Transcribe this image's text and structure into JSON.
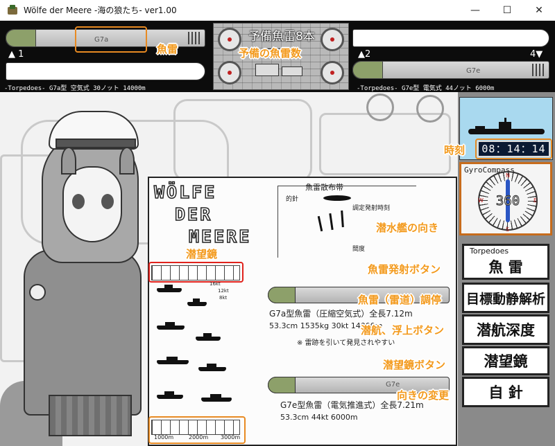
{
  "window": {
    "title": "Wölfe der Meere -海の狼たち- ver1.00",
    "minimize": "—",
    "maximize": "☐",
    "close": "✕"
  },
  "topbar": {
    "reserve_text": "予備魚雷8本",
    "tube1": {
      "number": "▲ 1",
      "torpedo_type": "G7a",
      "info": "-Torpedoes-  G7a型 空気式   30ノット  14000m"
    },
    "tube2": {
      "number": "▲2"
    },
    "tube4": {
      "number": "4▼",
      "torpedo_type": "G7e",
      "info": "-Torpedoes-  G7e型 電気式   44ノット  6000m"
    }
  },
  "clock": {
    "time": "08：14：14"
  },
  "compass": {
    "title": "GyroCompass",
    "heading": "360",
    "marks": [
      "N",
      "E",
      "S",
      "W"
    ]
  },
  "buttons": {
    "fire_caption": "Torpedoes",
    "fire": "魚 雷",
    "analysis": "目標動静解析",
    "depth": "潜航深度",
    "periscope": "潜望鏡",
    "heading": "自 針"
  },
  "annotations": {
    "torpedo": "魚雷",
    "reserve": "予備の魚雷数",
    "time": "時刻",
    "sub_heading": "潜水艦の向き",
    "periscope": "潜望鏡",
    "fire_button": "魚雷発射ボタン",
    "adjust": "魚雷（雷道）調停",
    "dive_button": "潜航、浮上ボタン",
    "periscope_button": "潜望鏡ボタン",
    "change_heading": "向きの変更"
  },
  "manual": {
    "logo_line1": "WÖLFE",
    "logo_line2": "DER",
    "logo_line3": "MEERE",
    "spread_title": "魚雷散布帯",
    "spread_heading": "的針",
    "spread_offset": "調定発射時刻",
    "spread_gap": "間度",
    "range_marks": [
      "16kt",
      "12kt",
      "8kt"
    ],
    "g7a_desc": "G7a型魚雷（圧縮空気式）全長7.12m",
    "g7a_spec": "53.3cm  1535kg  30kt  14000m",
    "g7a_note": "※ 雷跡を引いて発見されやすい",
    "g7e_label": "G7e",
    "g7e_desc": "G7e型魚雷（電気推進式）全長7.21m",
    "g7e_spec": "53.3cm  44kt  6000m",
    "scale": [
      "1000m",
      "2000m",
      "3000m"
    ]
  }
}
